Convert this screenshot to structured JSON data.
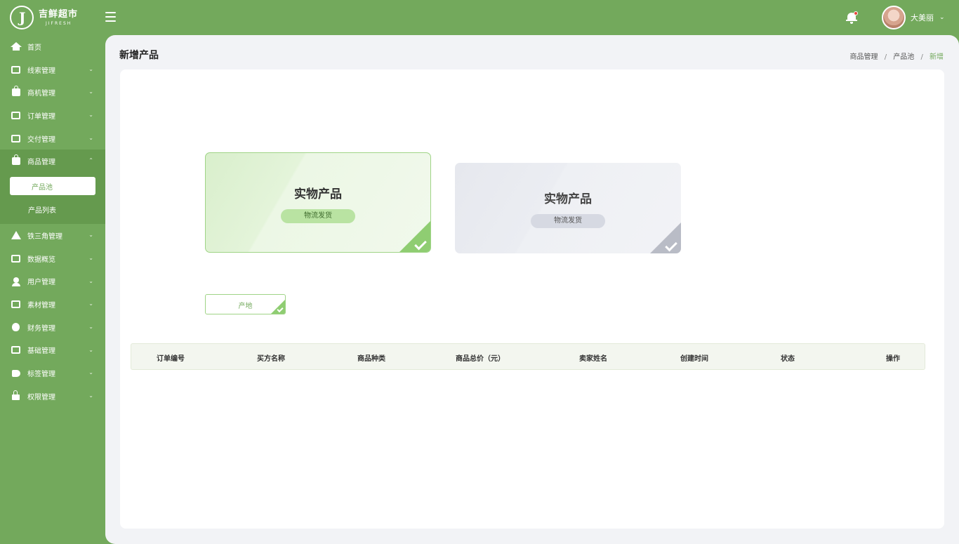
{
  "brand": {
    "name_cn": "吉鲜超市",
    "name_en": "JIFRESH",
    "logo_letter": "J"
  },
  "user": {
    "name": "大美丽",
    "caret": "⌄"
  },
  "icons": {
    "menu": "menu-icon",
    "bell": "bell-icon",
    "notification": true
  },
  "sidebar": {
    "items": [
      {
        "label": "首页",
        "icon": "home-icon",
        "caret": ""
      },
      {
        "label": "线索管理",
        "icon": "clue-icon",
        "caret": "⌄"
      },
      {
        "label": "商机管理",
        "icon": "opportunity-icon",
        "caret": "⌄"
      },
      {
        "label": "订单管理",
        "icon": "order-icon",
        "caret": "⌄"
      },
      {
        "label": "交付管理",
        "icon": "delivery-icon",
        "caret": "⌄"
      },
      {
        "label": "商品管理",
        "icon": "product-bag-icon",
        "caret": "⌃"
      },
      {
        "label": "铁三角管理",
        "icon": "triangle-icon",
        "caret": "⌄"
      },
      {
        "label": "数据概览",
        "icon": "data-icon",
        "caret": "⌄"
      },
      {
        "label": "用户管理",
        "icon": "user-icon",
        "caret": "⌄"
      },
      {
        "label": "素材管理",
        "icon": "material-icon",
        "caret": "⌄"
      },
      {
        "label": "财务管理",
        "icon": "finance-icon",
        "caret": "⌄"
      },
      {
        "label": "基础管理",
        "icon": "basic-icon",
        "caret": "⌄"
      },
      {
        "label": "标签管理",
        "icon": "tag-icon",
        "caret": "⌄"
      },
      {
        "label": "权限管理",
        "icon": "lock-icon",
        "caret": "⌄"
      }
    ],
    "submenu": [
      {
        "label": "产品池",
        "active": true
      },
      {
        "label": "产品列表",
        "active": false
      }
    ]
  },
  "page": {
    "title": "新增产品",
    "breadcrumb": {
      "a": "商品管理",
      "b": "产品池",
      "c": "新增",
      "sep": "/"
    }
  },
  "cards": [
    {
      "title": "实物产品",
      "tag": "物流发货",
      "selected": true
    },
    {
      "title": "实物产品",
      "tag": "物流发货",
      "selected": false
    }
  ],
  "origin_button": {
    "label": "产地"
  },
  "table": {
    "headers": [
      "订单编号",
      "买方名称",
      "商品种类",
      "商品总价（元）",
      "卖家姓名",
      "创建时间",
      "状态",
      "操作"
    ]
  },
  "colors": {
    "brand_green": "#73a95c",
    "selected_border": "#9fd486",
    "corner_green": "#8fcd72",
    "background": "#f2f3f6"
  }
}
